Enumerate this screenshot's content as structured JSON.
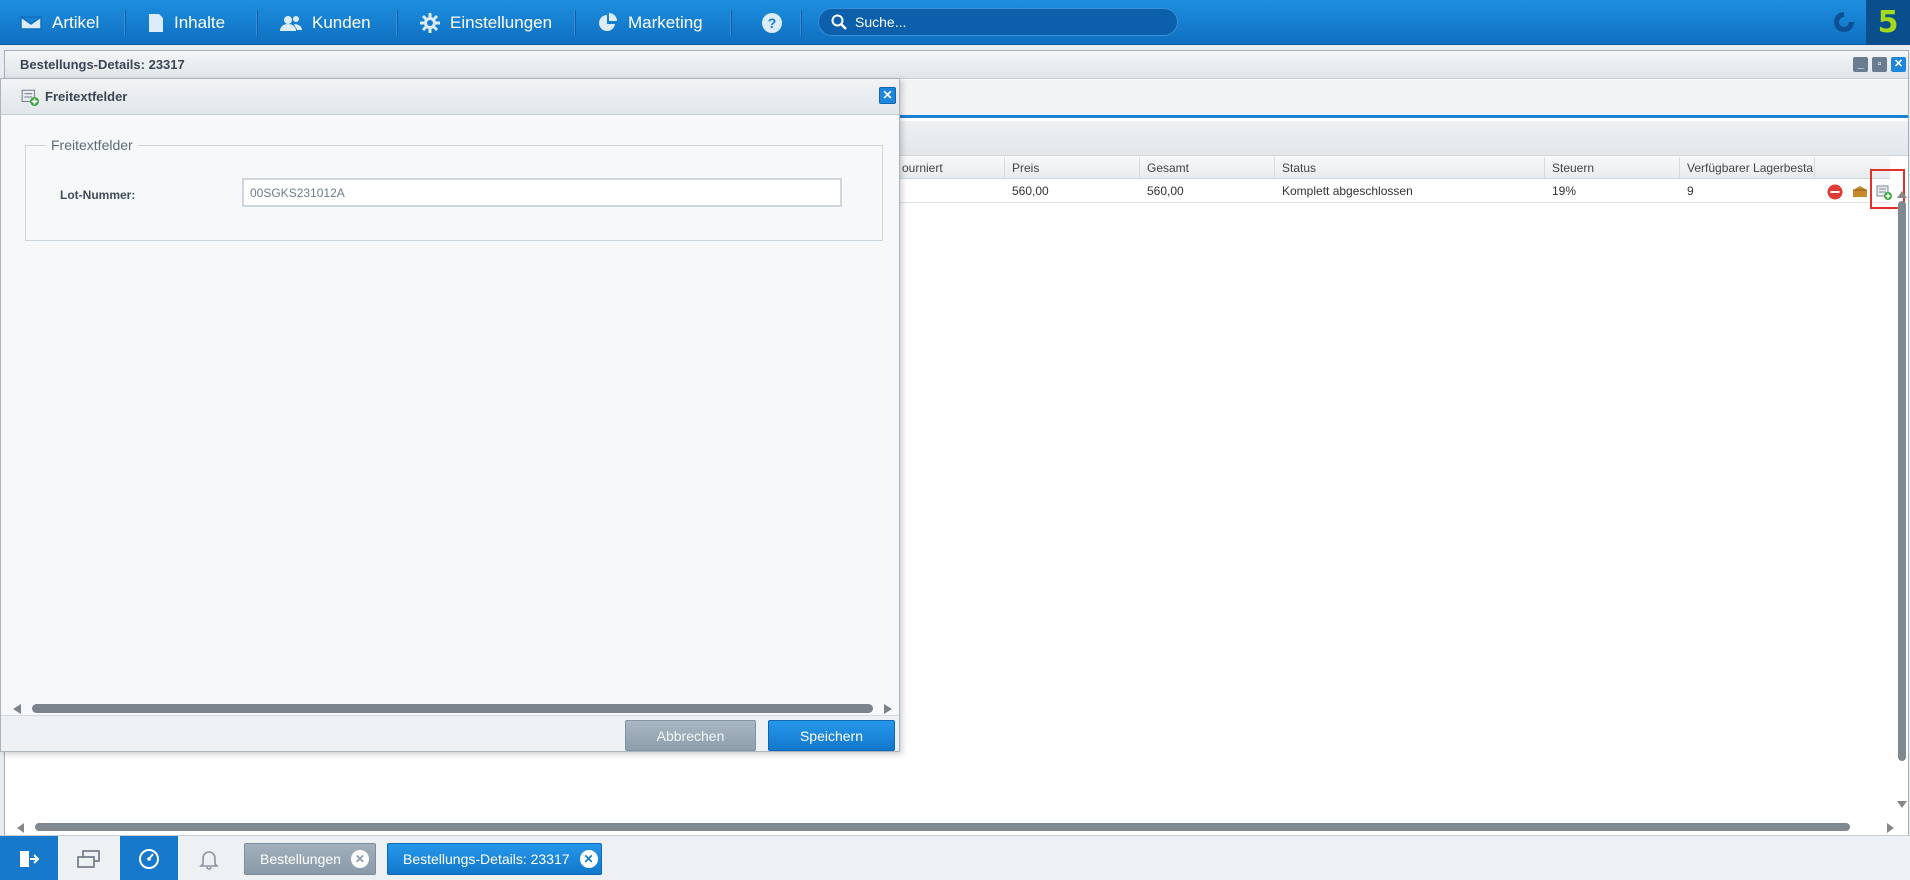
{
  "nav": {
    "items": [
      {
        "label": "Artikel",
        "icon": "inbox-icon"
      },
      {
        "label": "Inhalte",
        "icon": "document-icon"
      },
      {
        "label": "Kunden",
        "icon": "users-icon"
      },
      {
        "label": "Einstellungen",
        "icon": "gear-icon"
      },
      {
        "label": "Marketing",
        "icon": "pie-chart-icon"
      }
    ],
    "help_icon": "help-icon",
    "search_placeholder": "Suche...",
    "logo_text": "5"
  },
  "main_window": {
    "title": "Bestellungs-Details: 23317",
    "columns": [
      "ourniert",
      "Preis",
      "Gesamt",
      "Status",
      "Steuern",
      "Verfügbarer Lagerbesta"
    ],
    "row": {
      "preis": "560,00",
      "gesamt": "560,00",
      "status": "Komplett abgeschlossen",
      "steuern": "19%",
      "lager": "9"
    }
  },
  "dialog": {
    "title": "Freitextfelder",
    "fieldset_legend": "Freitextfelder",
    "field_label": "Lot-Nummer:",
    "field_value": "00SGKS231012A",
    "cancel_label": "Abbrechen",
    "save_label": "Speichern"
  },
  "taskbar": {
    "tabs": [
      {
        "label": "Bestellungen",
        "active": false
      },
      {
        "label": "Bestellungs-Details: 23317",
        "active": true
      }
    ]
  },
  "colors": {
    "nav_bg": "#1679cc",
    "accent": "#1980d6",
    "highlight": "#e0322c",
    "logo": "#a6d91c"
  }
}
